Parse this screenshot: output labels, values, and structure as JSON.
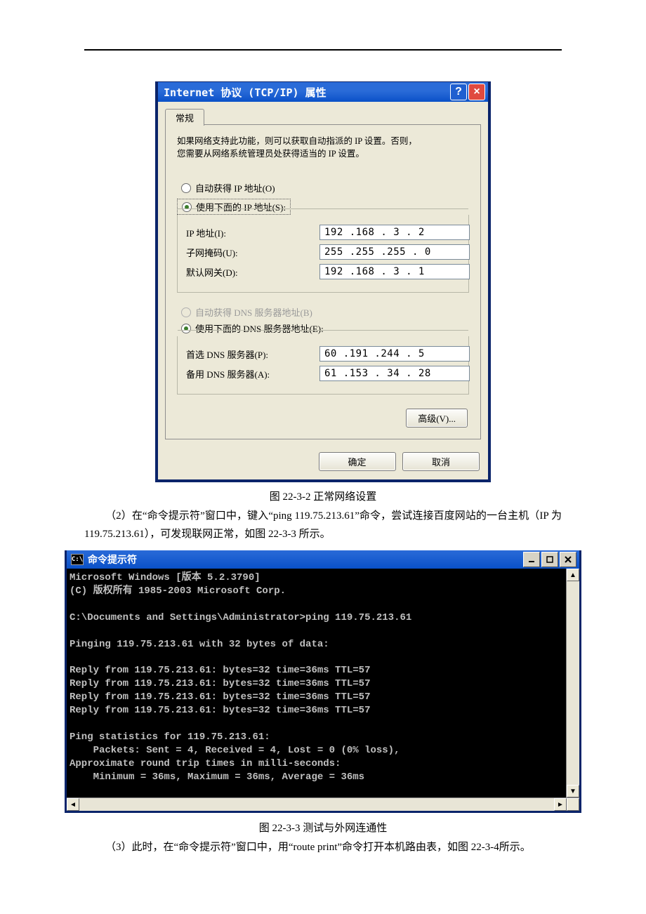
{
  "tcpip": {
    "title": "Internet 协议 (TCP/IP) 属性",
    "tab": "常规",
    "intro1": "如果网络支持此功能，则可以获取自动指派的 IP 设置。否则，",
    "intro2": "您需要从网络系统管理员处获得适当的 IP 设置。",
    "radio_auto_ip": "自动获得 IP 地址(O)",
    "radio_use_ip": "使用下面的 IP 地址(S):",
    "lbl_ip": "IP 地址(I):",
    "lbl_mask": "子网掩码(U):",
    "lbl_gw": "默认网关(D):",
    "val_ip": "192 .168 . 3  . 2",
    "val_mask": "255 .255 .255 . 0",
    "val_gw": "192 .168 . 3  . 1",
    "radio_auto_dns": "自动获得 DNS 服务器地址(B)",
    "radio_use_dns": "使用下面的 DNS 服务器地址(E):",
    "lbl_dns1": "首选 DNS 服务器(P):",
    "lbl_dns2": "备用 DNS 服务器(A):",
    "val_dns1": "60  .191 .244 . 5",
    "val_dns2": "61  .153 . 34 . 28",
    "btn_adv": "高级(V)...",
    "btn_ok": "确定",
    "btn_cancel": "取消"
  },
  "caption1": "图 22-3-2   正常网络设置",
  "para1": "（2）在“命令提示符”窗口中，键入“ping 119.75.213.61”命令，尝试连接百度网站的一台主机（IP 为 119.75.213.61），可发现联网正常，如图 22-3-3 所示。",
  "cmd": {
    "title": "命令提示符",
    "icon": "C:\\",
    "lines": "Microsoft Windows [版本 5.2.3790]\n(C) 版权所有 1985-2003 Microsoft Corp.\n\nC:\\Documents and Settings\\Administrator>ping 119.75.213.61\n\nPinging 119.75.213.61 with 32 bytes of data:\n\nReply from 119.75.213.61: bytes=32 time=36ms TTL=57\nReply from 119.75.213.61: bytes=32 time=36ms TTL=57\nReply from 119.75.213.61: bytes=32 time=36ms TTL=57\nReply from 119.75.213.61: bytes=32 time=36ms TTL=57\n\nPing statistics for 119.75.213.61:\n    Packets: Sent = 4, Received = 4, Lost = 0 (0% loss),\nApproximate round trip times in milli-seconds:\n    Minimum = 36ms, Maximum = 36ms, Average = 36ms\n"
  },
  "caption2": "图 22-3-3   测试与外网连通性",
  "para2": "（3）此时，在“命令提示符”窗口中，用“route  print”命令打开本机路由表，如图 22-3-4所示。"
}
